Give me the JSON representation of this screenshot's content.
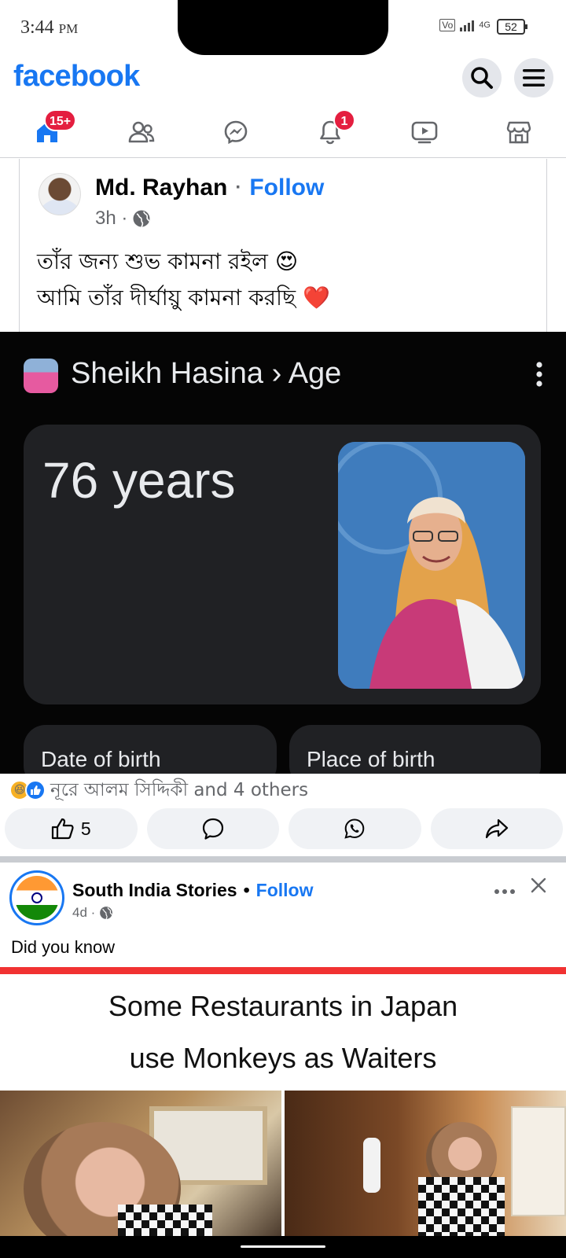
{
  "status_bar": {
    "time": "3:44",
    "ampm": "PM",
    "network": "VoLTE",
    "signal": "4G",
    "battery": "52"
  },
  "header": {
    "logo": "facebook",
    "icons": [
      "search-icon",
      "menu-icon"
    ]
  },
  "nav": {
    "items": [
      {
        "name": "home",
        "icon": "home-icon",
        "badge": "15+",
        "active": true
      },
      {
        "name": "friends",
        "icon": "friends-icon",
        "badge": ""
      },
      {
        "name": "messenger",
        "icon": "messenger-icon",
        "badge": ""
      },
      {
        "name": "notifications",
        "icon": "bell-icon",
        "badge": "1"
      },
      {
        "name": "video",
        "icon": "video-icon",
        "badge": ""
      },
      {
        "name": "marketplace",
        "icon": "marketplace-icon",
        "badge": ""
      }
    ],
    "badge_color": "#e41e3f",
    "accent": "#1877f2"
  },
  "post1": {
    "author": "Md. Rayhan",
    "separator": "·",
    "follow": "Follow",
    "time": "3h ·",
    "text_line1": "তাঁর জন্য শুভ কামনা রইল",
    "text_emoji1": "😍",
    "text_line2": "আমি তাঁর দীর্ঘায়ু কামনা করছি",
    "text_emoji2": "❤️",
    "media": {
      "title": "Sheikh Hasina › Age",
      "age": "76 years",
      "field1": "Date of birth",
      "field2": "Place of birth"
    },
    "reactions_text": "নূরে আলম সিদ্দিকী and 4 others",
    "reaction_icons": [
      "haha-icon",
      "like-icon"
    ],
    "like_count": "5"
  },
  "post2": {
    "author": "South India Stories",
    "separator": "•",
    "follow": "Follow",
    "time": "4d ·",
    "text": "Did you know",
    "heading_line1": "Some Restaurants in Japan",
    "heading_line2": "use Monkeys as Waiters"
  }
}
